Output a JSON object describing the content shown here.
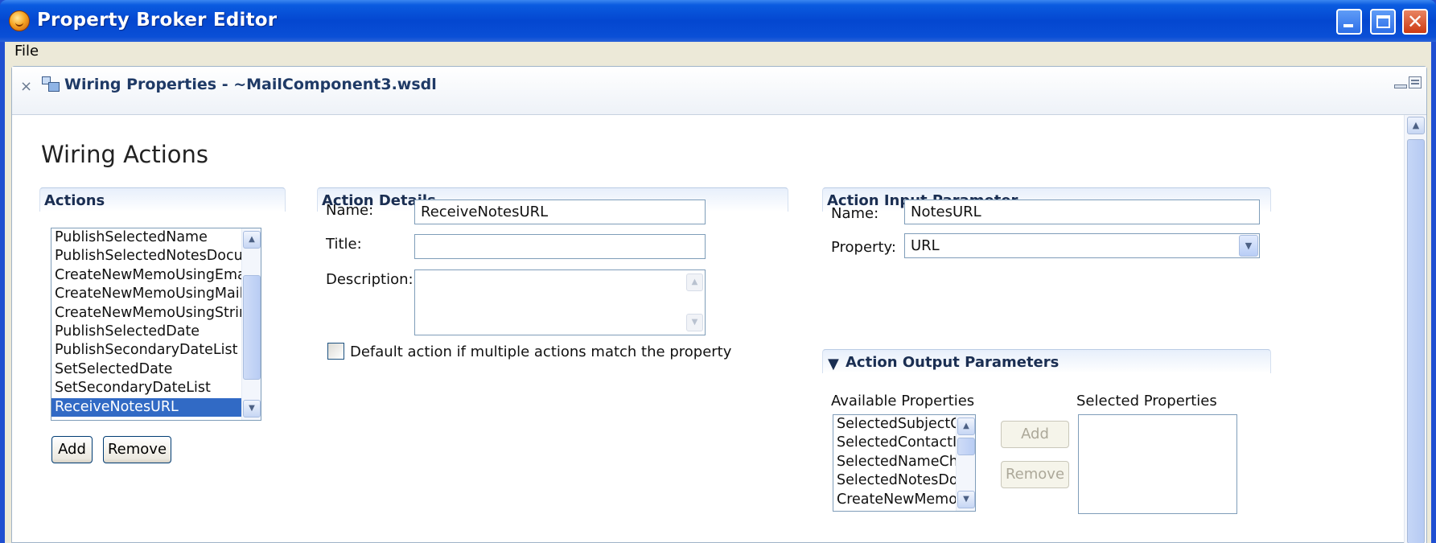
{
  "window": {
    "title": "Property Broker Editor",
    "minimize": "minimize",
    "maximize": "maximize",
    "close": "close"
  },
  "menubar": {
    "items": [
      "File"
    ]
  },
  "editor_tab": {
    "title": "Wiring Properties - ~MailComponent3.wsdl",
    "close_glyph": "×"
  },
  "page": {
    "heading": "Wiring Actions"
  },
  "actions": {
    "header": "Actions",
    "items": [
      "PublishSelectedName",
      "PublishSelectedNotesDocu",
      "CreateNewMemoUsingEma",
      "CreateNewMemoUsingMail",
      "CreateNewMemoUsingStrir",
      "PublishSelectedDate",
      "PublishSecondaryDateList",
      "SetSelectedDate",
      "SetSecondaryDateList",
      "ReceiveNotesURL"
    ],
    "selected_index": 9,
    "add_label": "Add",
    "remove_label": "Remove"
  },
  "action_details": {
    "header": "Action Details",
    "name_label": "Name:",
    "name_value": "ReceiveNotesURL",
    "title_label": "Title:",
    "title_value": "",
    "description_label": "Description:",
    "description_value": "",
    "default_checkbox_label": "Default action if multiple actions match the property",
    "default_checked": false
  },
  "action_input": {
    "header": "Action Input Parameter",
    "name_label": "Name:",
    "name_value": "NotesURL",
    "property_label": "Property:",
    "property_value": "URL"
  },
  "action_output": {
    "header": "Action Output Parameters",
    "available_label": "Available Properties",
    "selected_label": "Selected Properties",
    "available_items": [
      "SelectedSubjectCh",
      "SelectedContactID",
      "SelectedNameChar",
      "SelectedNotesDocu",
      "CreateNewMemoUs"
    ],
    "selected_items": [],
    "add_label": "Add",
    "remove_label": "Remove"
  },
  "icons": {
    "app": "app-globe-icon",
    "tab": "wiring-properties-icon",
    "scroll_up": "▲",
    "scroll_down": "▼",
    "combo": "▼",
    "twisty": "▼"
  },
  "colors": {
    "titlebar": "#0447d0",
    "selection": "#316ac5",
    "frame": "#ece9d8",
    "section_header_text": "#1a2e52"
  }
}
